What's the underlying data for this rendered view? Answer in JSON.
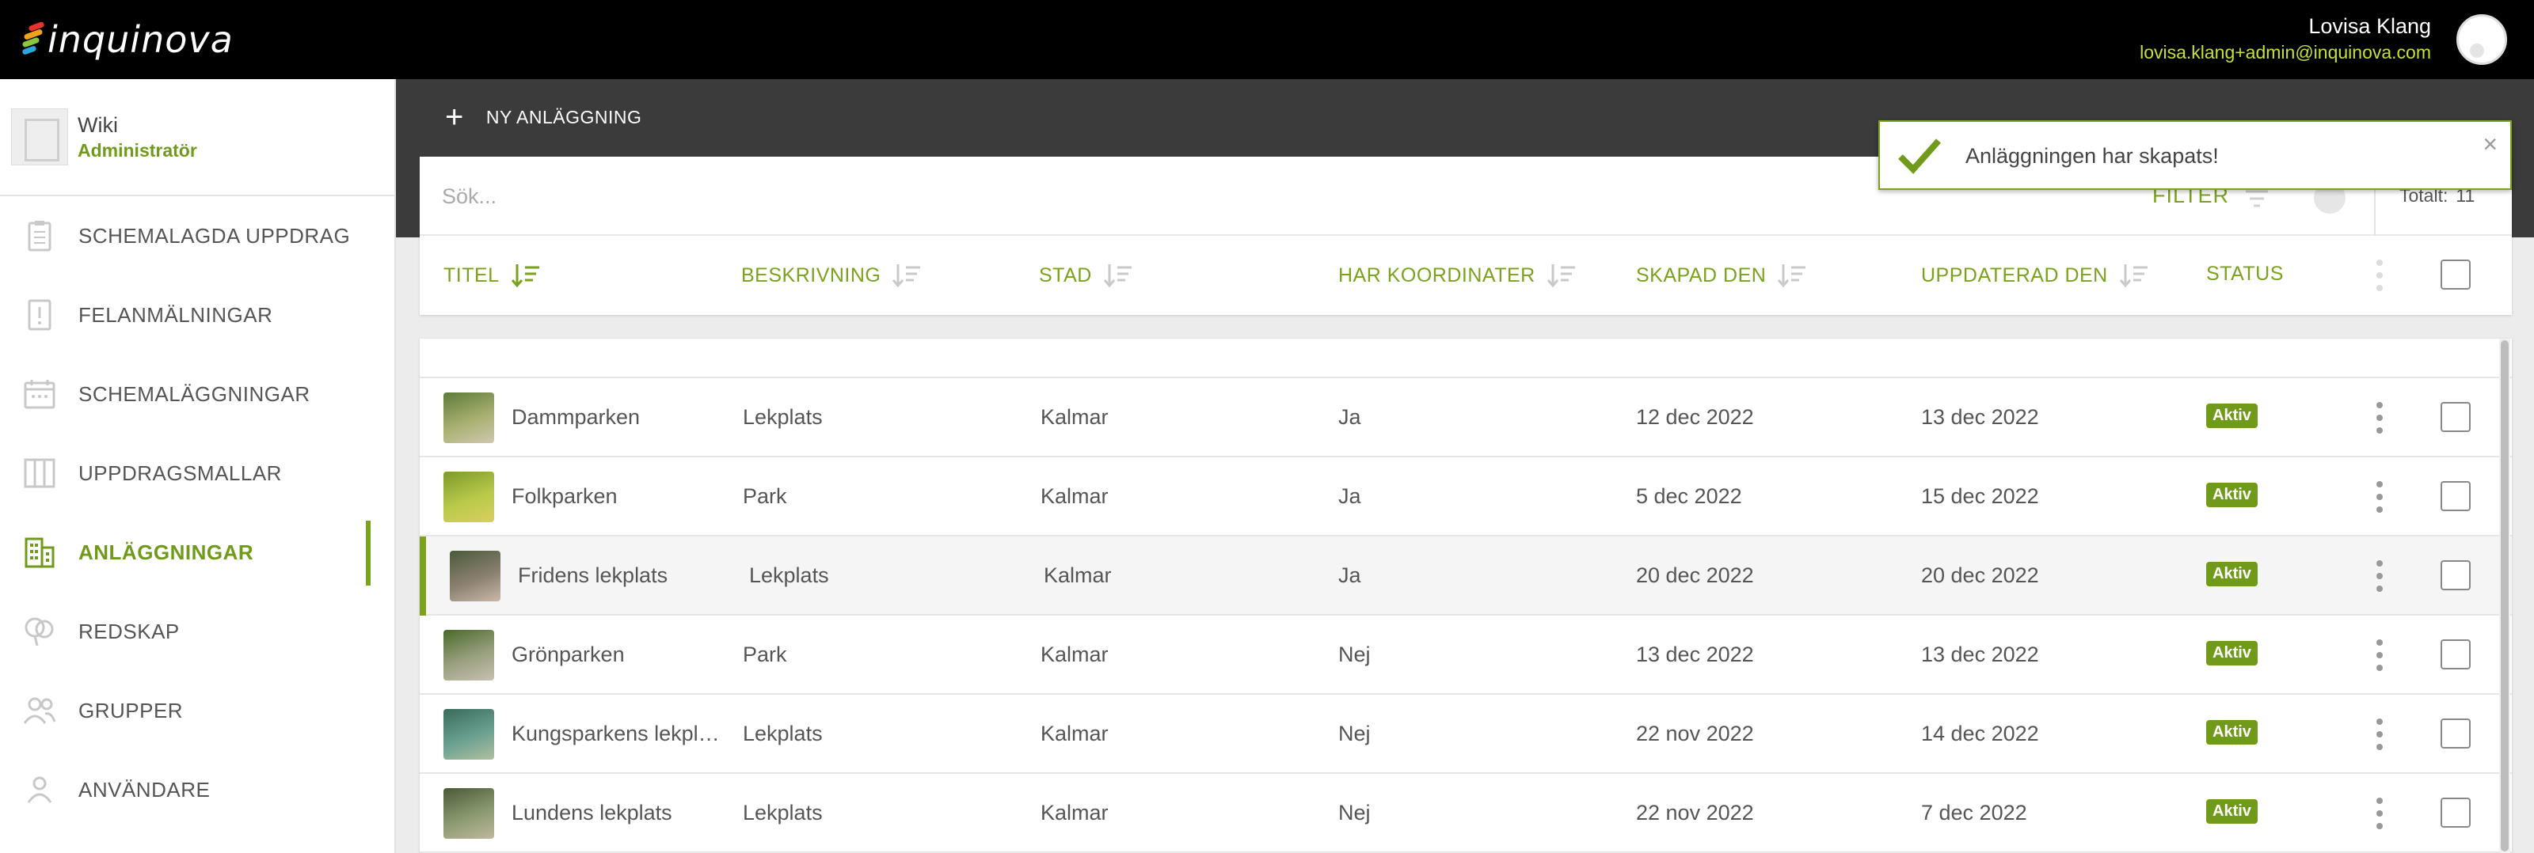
{
  "app": {
    "logo_text": "inquinova"
  },
  "user": {
    "name": "Lovisa Klang",
    "email": "lovisa.klang+admin@inquinova.com"
  },
  "workspace": {
    "name": "Wiki",
    "role": "Administratör"
  },
  "sidebar": {
    "items": [
      {
        "label": "SCHEMALAGDA UPPDRAG",
        "icon": "clipboard-icon"
      },
      {
        "label": "FELANMÄLNINGAR",
        "icon": "alert-report-icon"
      },
      {
        "label": "SCHEMALÄGGNINGAR",
        "icon": "calendar-icon"
      },
      {
        "label": "UPPDRAGSMALLAR",
        "icon": "template-icon"
      },
      {
        "label": "ANLÄGGNINGAR",
        "icon": "building-icon",
        "active": true
      },
      {
        "label": "REDSKAP",
        "icon": "equipment-icon"
      },
      {
        "label": "GRUPPER",
        "icon": "group-icon"
      },
      {
        "label": "ANVÄNDARE",
        "icon": "user-icon"
      }
    ]
  },
  "toolbar": {
    "new_label": "NY ANLÄGGNING"
  },
  "search": {
    "placeholder": "Sök...",
    "filter_label": "FILTER",
    "total_label": "Totalt:",
    "total_value": "11"
  },
  "table": {
    "headers": {
      "title": "TITEL",
      "description": "BESKRIVNING",
      "city": "STAD",
      "coords": "HAR KOORDINATER",
      "created": "SKAPAD DEN",
      "updated": "UPPDATERAD DEN",
      "status": "STATUS"
    },
    "rows": [
      {
        "title": "Dammparken",
        "description": "Lekplats",
        "city": "Kalmar",
        "coords": "Ja",
        "created": "12 dec 2022",
        "updated": "13 dec 2022",
        "status": "Aktiv"
      },
      {
        "title": "Folkparken",
        "description": "Park",
        "city": "Kalmar",
        "coords": "Ja",
        "created": "5 dec 2022",
        "updated": "15 dec 2022",
        "status": "Aktiv"
      },
      {
        "title": "Fridens lekplats",
        "description": "Lekplats",
        "city": "Kalmar",
        "coords": "Ja",
        "created": "20 dec 2022",
        "updated": "20 dec 2022",
        "status": "Aktiv",
        "highlighted": true
      },
      {
        "title": "Grönparken",
        "description": "Park",
        "city": "Kalmar",
        "coords": "Nej",
        "created": "13 dec 2022",
        "updated": "13 dec 2022",
        "status": "Aktiv"
      },
      {
        "title": "Kungsparkens lekpl…",
        "description": "Lekplats",
        "city": "Kalmar",
        "coords": "Nej",
        "created": "22 nov 2022",
        "updated": "14 dec 2022",
        "status": "Aktiv"
      },
      {
        "title": "Lundens lekplats",
        "description": "Lekplats",
        "city": "Kalmar",
        "coords": "Nej",
        "created": "22 nov 2022",
        "updated": "7 dec 2022",
        "status": "Aktiv"
      }
    ]
  },
  "toast": {
    "message": "Anläggningen har skapats!"
  },
  "colors": {
    "accent": "#7aa21d",
    "email": "#c6e03a",
    "topbar": "#000000",
    "band": "#3b3b3b"
  }
}
